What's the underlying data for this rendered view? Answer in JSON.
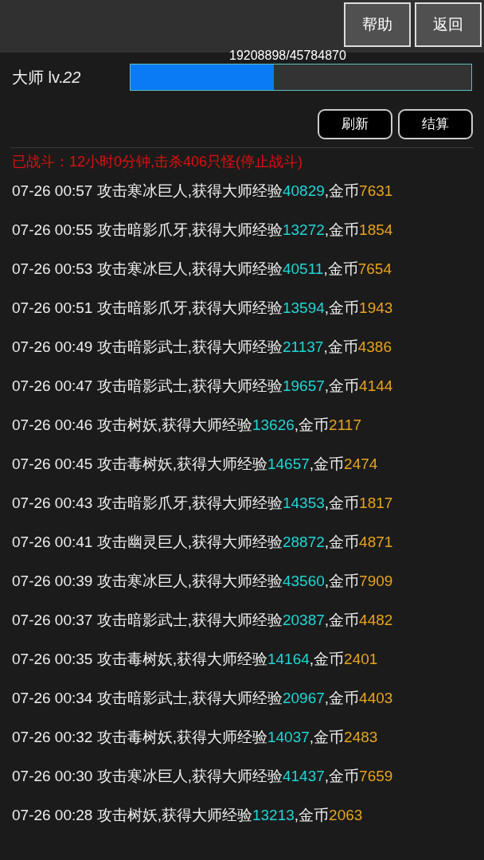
{
  "header": {
    "buttons": [
      "帮助",
      "返回"
    ]
  },
  "master": {
    "label": "大师 lv.*22*",
    "progress_text": "19208898/45784870",
    "level": 0.42
  },
  "actions": [
    "刷新",
    "结算"
  ],
  "status": "已战斗：12小时0分钟,击杀406只怪(停止战斗)",
  "log": [
    {
      "text": "07-26 00:57 攻击寒冰巨人,获得大师经验",
      "exp": "40829",
      "sep": ",金币",
      "gold": "7631"
    },
    {
      "text": "07-26 00:55 攻击暗影爪牙,获得大师经验",
      "exp": "13272",
      "sep": ",金币",
      "gold": "1854"
    },
    {
      "text": "07-26 00:53 攻击寒冰巨人,获得大师经验",
      "exp": "40511",
      "sep": ",金币",
      "gold": "7654"
    },
    {
      "text": "07-26 00:51 攻击暗影爪牙,获得大师经验",
      "exp": "13594",
      "sep": ",金币",
      "gold": "1943"
    },
    {
      "text": "07-26 00:49 攻击暗影武士,获得大师经验",
      "exp": "21137",
      "sep": ",金币",
      "gold": "4386"
    },
    {
      "text": "07-26 00:47 攻击暗影武士,获得大师经验",
      "exp": "19657",
      "sep": ",金币",
      "gold": "4144"
    },
    {
      "text": "07-26 00:46 攻击树妖,获得大师经验",
      "exp": "13626",
      "sep": ",金币",
      "gold": "2117"
    },
    {
      "text": "07-26 00:45 攻击毒树妖,获得大师经验",
      "exp": "14657",
      "sep": ",金币",
      "gold": "2474"
    },
    {
      "text": "07-26 00:43 攻击暗影爪牙,获得大师经验",
      "exp": "14353",
      "sep": ",金币",
      "gold": "1817"
    },
    {
      "text": "07-26 00:41 攻击幽灵巨人,获得大师经验",
      "exp": "28872",
      "sep": ",金币",
      "gold": "4871"
    },
    {
      "text": "07-26 00:39 攻击寒冰巨人,获得大师经验",
      "exp": "43560",
      "sep": ",金币",
      "gold": "7909"
    },
    {
      "text": "07-26 00:37 攻击暗影武士,获得大师经验",
      "exp": "20387",
      "sep": ",金币",
      "gold": "4482"
    },
    {
      "text": "07-26 00:35 攻击毒树妖,获得大师经验",
      "exp": "14164",
      "sep": ",金币",
      "gold": "2401"
    },
    {
      "text": "07-26 00:34 攻击暗影武士,获得大师经验",
      "exp": "20967",
      "sep": ",金币",
      "gold": "4403"
    },
    {
      "text": "07-26 00:32 攻击毒树妖,获得大师经验",
      "exp": "14037",
      "sep": ",金币",
      "gold": "2483"
    },
    {
      "text": "07-26 00:30 攻击寒冰巨人,获得大师经验",
      "exp": "41437",
      "sep": ",金币",
      "gold": "7659"
    },
    {
      "text": "07-26 00:28 攻击树妖,获得大师经验",
      "exp": "13213",
      "sep": ",金币",
      "gold": "2063"
    }
  ]
}
